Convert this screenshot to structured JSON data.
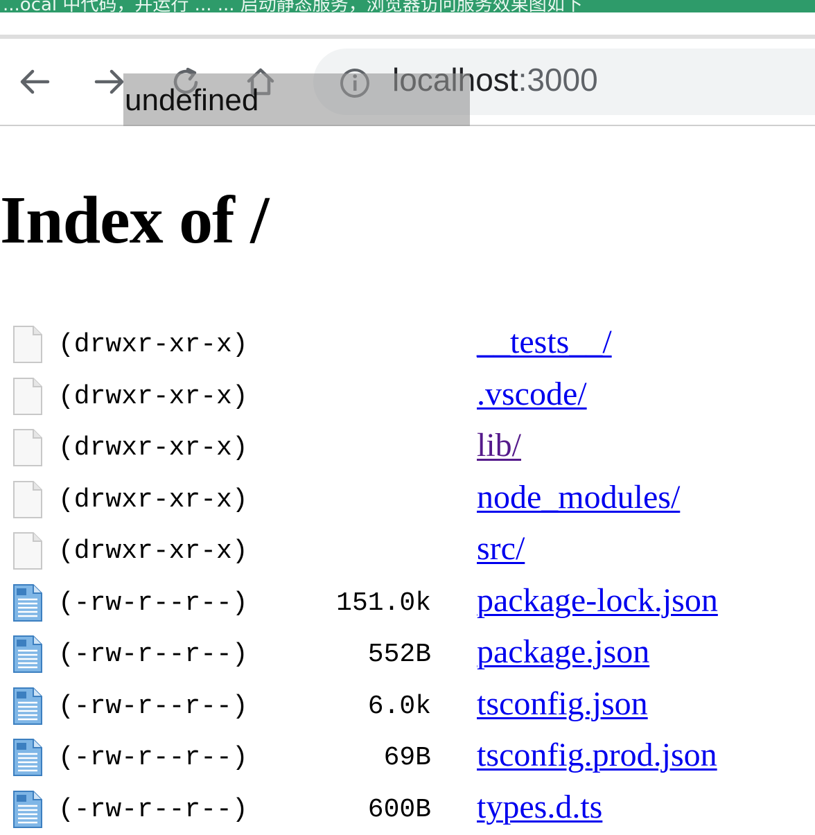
{
  "browser": {
    "top_strip_text": "...ocal 中代码，并运行 ... ... 启动静态服务，浏览器访问服务效果图如下",
    "url_host": "localhost",
    "url_port": ":3000",
    "tooltip": "undefined"
  },
  "page": {
    "title": "Index of /"
  },
  "entries": [
    {
      "perm": "(drwxr-xr-x)",
      "size": "",
      "name": "__tests__/",
      "type": "dir",
      "visited": false
    },
    {
      "perm": "(drwxr-xr-x)",
      "size": "",
      "name": ".vscode/",
      "type": "dir",
      "visited": false
    },
    {
      "perm": "(drwxr-xr-x)",
      "size": "",
      "name": "lib/",
      "type": "dir",
      "visited": true
    },
    {
      "perm": "(drwxr-xr-x)",
      "size": "",
      "name": "node_modules/",
      "type": "dir",
      "visited": false
    },
    {
      "perm": "(drwxr-xr-x)",
      "size": "",
      "name": "src/",
      "type": "dir",
      "visited": false
    },
    {
      "perm": "(-rw-r--r--)",
      "size": "151.0k",
      "name": "package-lock.json",
      "type": "file",
      "visited": false
    },
    {
      "perm": "(-rw-r--r--)",
      "size": "552B",
      "name": "package.json",
      "type": "file",
      "visited": false
    },
    {
      "perm": "(-rw-r--r--)",
      "size": "6.0k",
      "name": "tsconfig.json",
      "type": "file",
      "visited": false
    },
    {
      "perm": "(-rw-r--r--)",
      "size": "69B",
      "name": "tsconfig.prod.json",
      "type": "file",
      "visited": false
    },
    {
      "perm": "(-rw-r--r--)",
      "size": "600B",
      "name": "types.d.ts",
      "type": "file",
      "visited": false
    }
  ],
  "colors": {
    "link": "#0000ee",
    "visited_link": "#551a8b",
    "top_strip": "#2e9b6a"
  }
}
